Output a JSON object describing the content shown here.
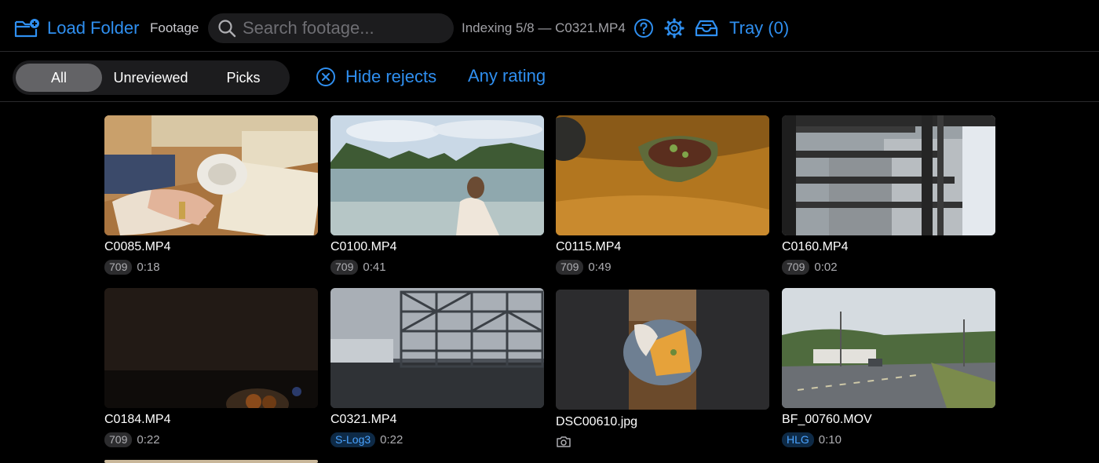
{
  "toolbar": {
    "load_folder_label": "Load Folder",
    "source_label": "Footage",
    "search_placeholder": "Search footage...",
    "indexing_status": "Indexing 5/8 — C0321.MP4",
    "tray_label": "Tray (0)"
  },
  "filters": {
    "segments": [
      "All",
      "Unreviewed",
      "Picks"
    ],
    "selected_segment": "All",
    "hide_rejects_label": "Hide rejects",
    "rating_label": "Any rating"
  },
  "clips": [
    {
      "name": "C0085.MP4",
      "profile": "709",
      "duration": "0:18"
    },
    {
      "name": "C0100.MP4",
      "profile": "709",
      "duration": "0:41"
    },
    {
      "name": "C0115.MP4",
      "profile": "709",
      "duration": "0:49"
    },
    {
      "name": "C0160.MP4",
      "profile": "709",
      "duration": "0:02"
    },
    {
      "name": "C0184.MP4",
      "profile": "709",
      "duration": "0:22"
    },
    {
      "name": "C0321.MP4",
      "profile": "S-Log3",
      "duration": "0:22"
    },
    {
      "name": "DSC00610.jpg",
      "icon": "camera-icon"
    },
    {
      "name": "BF_00760.MOV",
      "profile": "HLG",
      "duration": "0:10"
    }
  ],
  "colors": {
    "accent": "#2f8ff0",
    "background": "#000000",
    "log_badge_bg": "#0e2a46",
    "log_badge_text": "#4aa3ff"
  }
}
